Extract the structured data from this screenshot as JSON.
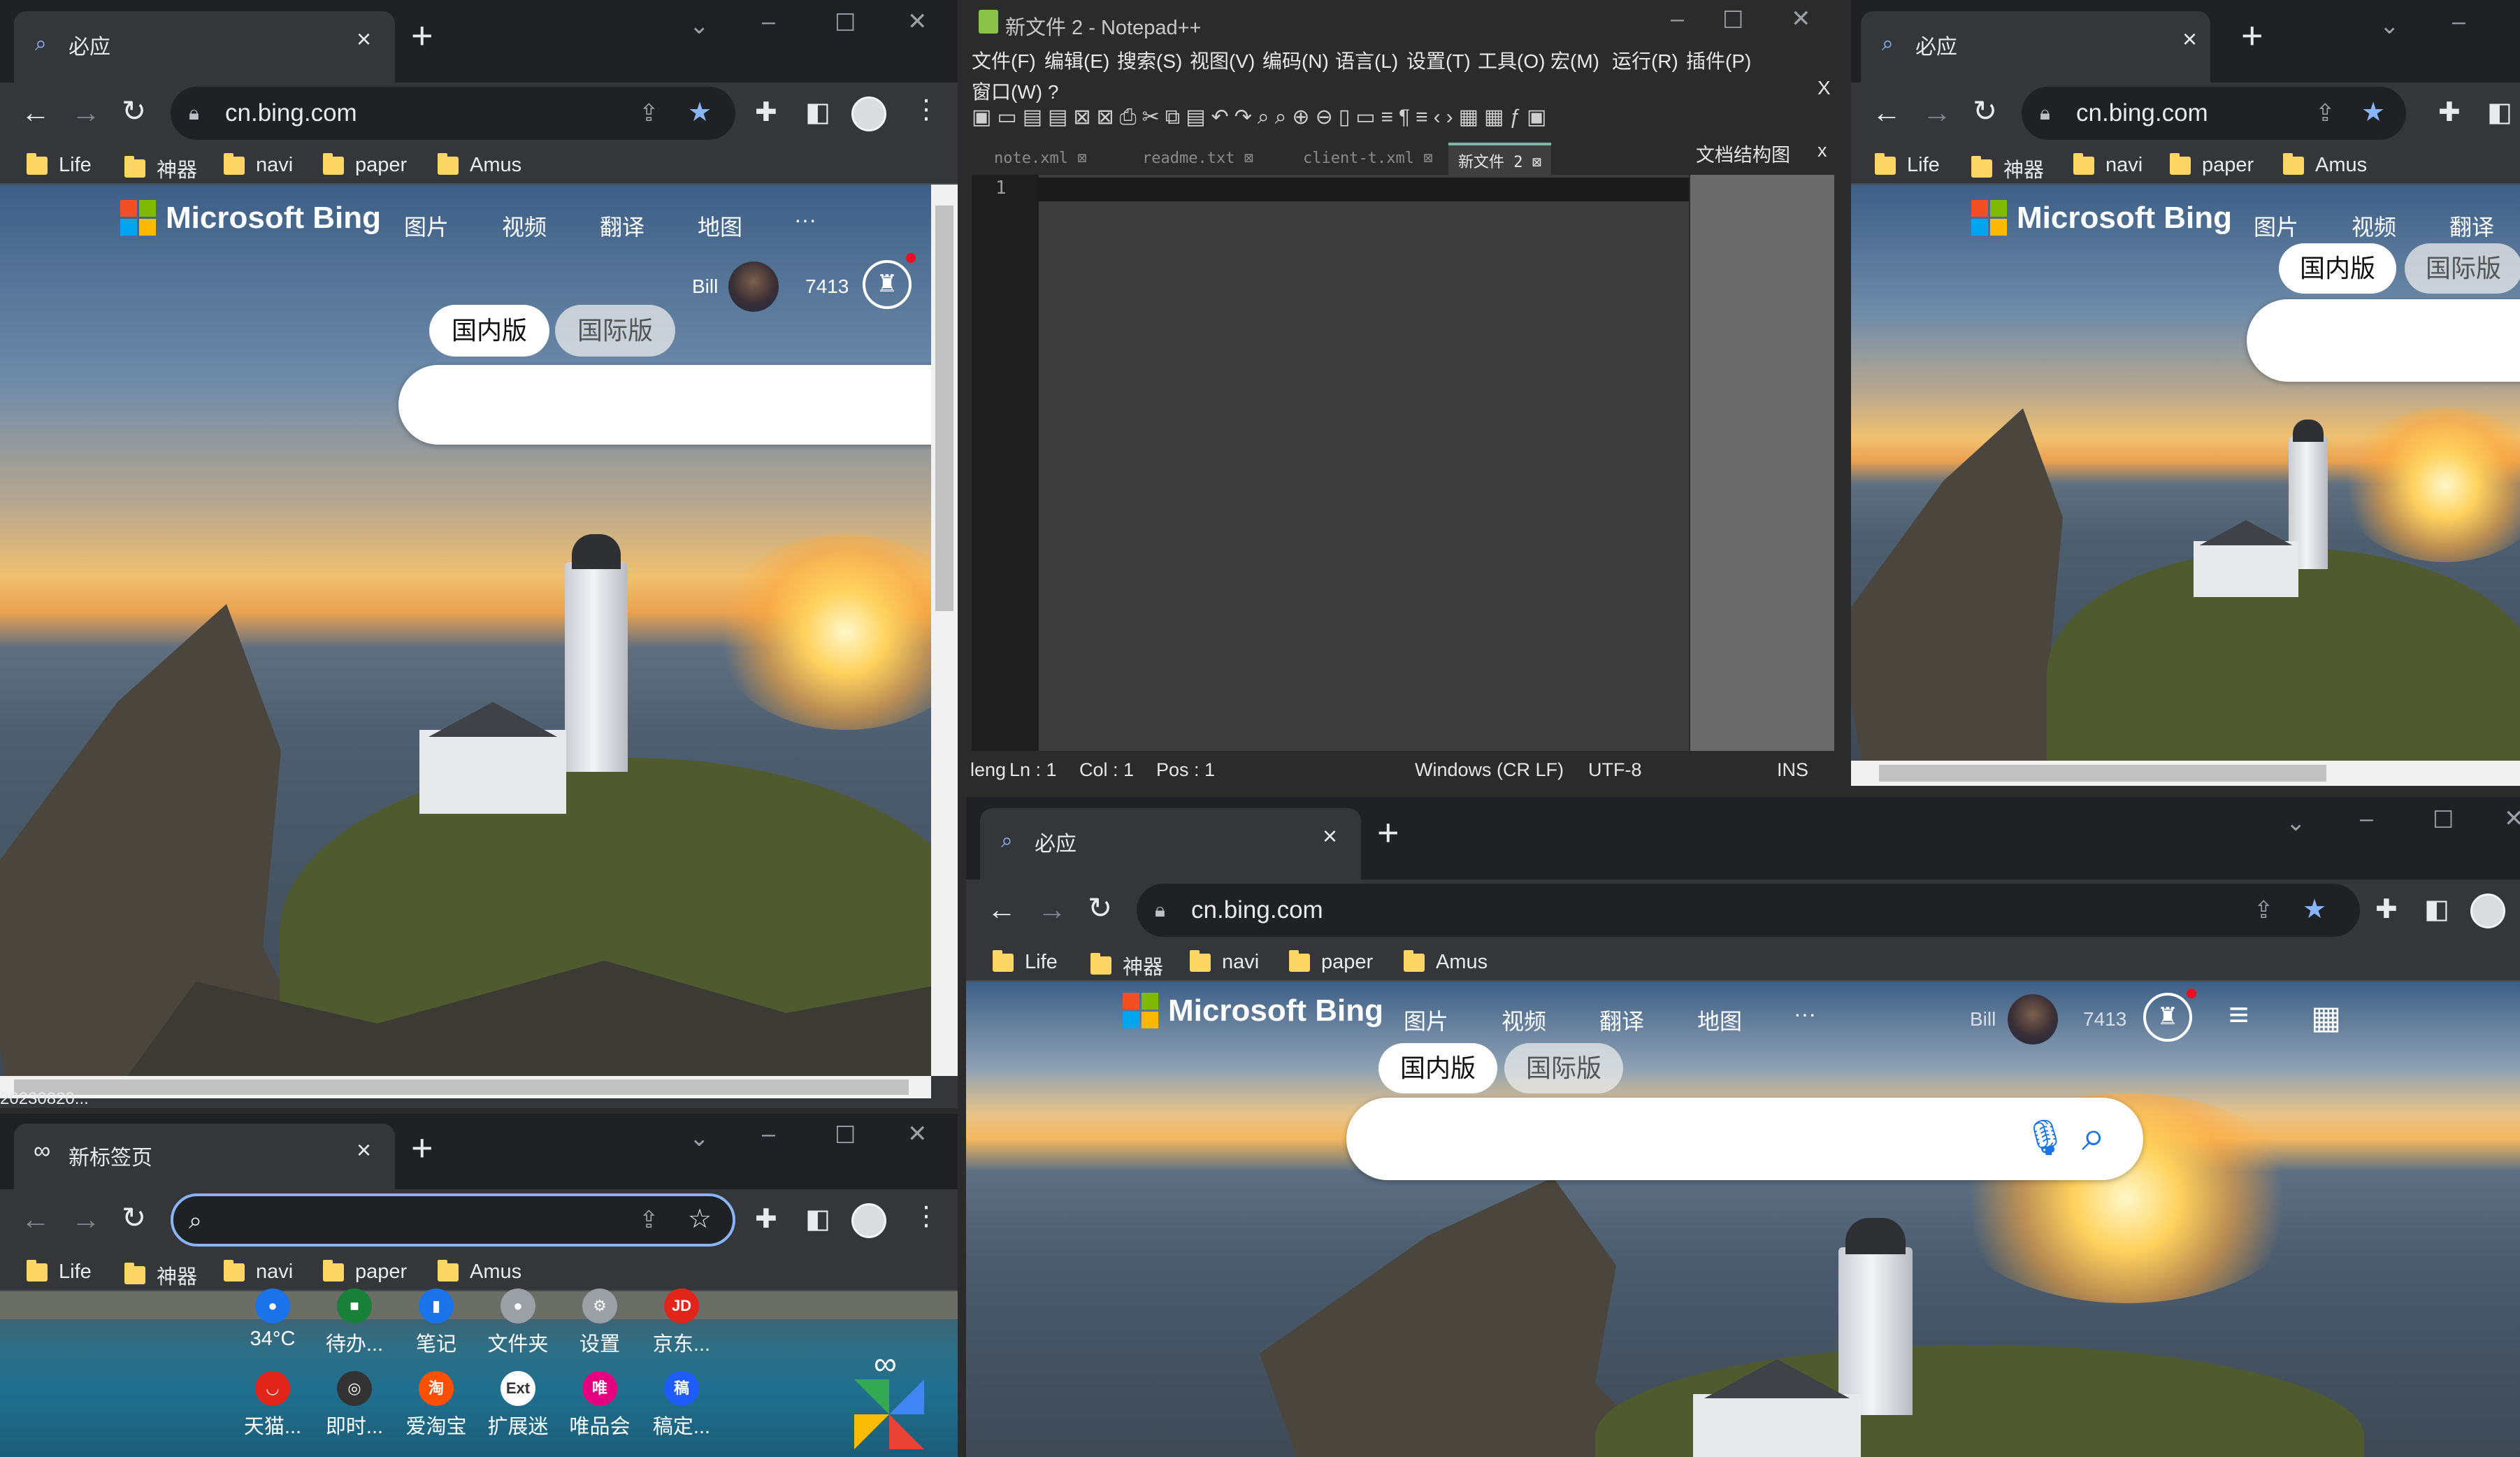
{
  "browser": {
    "bing_tab_title": "必应",
    "newtab_title": "新标签页",
    "url": "cn.bing.com",
    "bookmarks": [
      "Life",
      "神器",
      "navi",
      "paper",
      "Amus"
    ]
  },
  "bing": {
    "logo_text": "Microsoft Bing",
    "nav": [
      "图片",
      "视频",
      "翻译",
      "地图",
      "···"
    ],
    "user_name": "Bill",
    "points": "7413",
    "region_domestic": "国内版",
    "region_international": "国际版"
  },
  "notepad": {
    "title": "新文件 2 - Notepad++",
    "menu_row1": [
      "文件(F)",
      "编辑(E)",
      "搜索(S)",
      "视图(V)",
      "编码(N)",
      "语言(L)",
      "设置(T)",
      "工具(O)",
      "宏(M)",
      "运行(R)",
      "插件(P)"
    ],
    "menu_row2": "窗口(W)  ?",
    "menu_close": "X",
    "tabs": [
      "note.xml",
      "readme.txt",
      "client-t.xml",
      "新文件 2"
    ],
    "doc_map_title": "文档结构图",
    "doc_map_close": "x",
    "line_number": "1",
    "status": {
      "left": "leng",
      "ln": "Ln : 1",
      "col": "Col : 1",
      "pos": "Pos : 1",
      "eol": "Windows (CR LF)",
      "encoding": "UTF-8",
      "mode": "INS"
    }
  },
  "newtab": {
    "apps": [
      {
        "label": "34°C",
        "color": "#1a73e8"
      },
      {
        "label": "待办...",
        "color": "#188038"
      },
      {
        "label": "笔记",
        "color": "#1a73e8"
      },
      {
        "label": "文件夹",
        "color": "#9aa0a6"
      },
      {
        "label": "设置",
        "color": "#9aa0a6"
      },
      {
        "label": "京东...",
        "color": "#e1251b"
      },
      {
        "label": "天猫...",
        "color": "#e1251b"
      },
      {
        "label": "即时...",
        "color": "#333333"
      },
      {
        "label": "爱淘宝",
        "color": "#ff5000"
      },
      {
        "label": "扩展迷",
        "color": "#ffffff"
      },
      {
        "label": "唯品会",
        "color": "#e5007f"
      },
      {
        "label": "稿定...",
        "color": "#1f5cff"
      }
    ],
    "app_glyphs": [
      "●",
      "■",
      "▮",
      "●",
      "⚙",
      "JD",
      "◡",
      "◎",
      "淘",
      "Ext",
      "唯",
      "稿"
    ],
    "bottom_left_text": "20230820..."
  },
  "colors": {
    "chrome_dark": "#202124",
    "chrome_toolbar": "#35363a",
    "accent_blue": "#8ab4f8",
    "folder_yellow": "#fdd663"
  }
}
